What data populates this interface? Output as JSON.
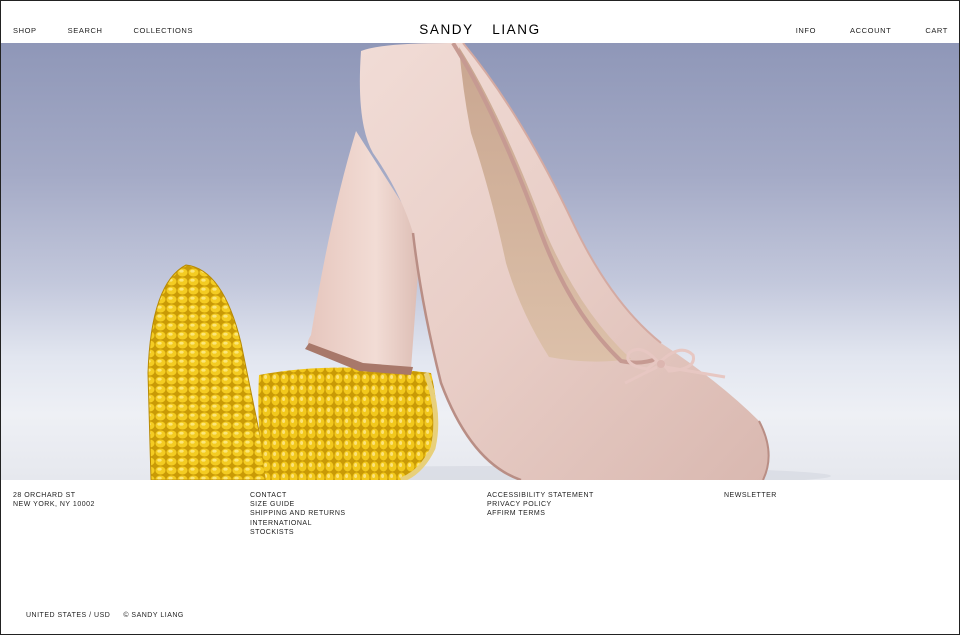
{
  "header": {
    "brand": "SANDY  LIANG",
    "nav_left": [
      {
        "label": "SHOP"
      },
      {
        "label": "SEARCH"
      },
      {
        "label": "COLLECTIONS"
      }
    ],
    "nav_right": [
      {
        "label": "INFO"
      },
      {
        "label": "ACCOUNT"
      },
      {
        "label": "CART"
      }
    ]
  },
  "hero": {
    "image_subject": "pink satin high-heel pump with bow resting on corn cobs",
    "colors": {
      "shoe": "#e9cfc8",
      "corn": "#f2c81c",
      "background_top": "#8f97b8"
    }
  },
  "footer": {
    "address": [
      "28 ORCHARD ST",
      "NEW YORK, NY 10002"
    ],
    "links_col1": [
      "CONTACT",
      "SIZE GUIDE",
      "SHIPPING AND RETURNS",
      "INTERNATIONAL",
      "STOCKISTS"
    ],
    "links_col2": [
      "ACCESSIBILITY STATEMENT",
      "PRIVACY POLICY",
      "AFFIRM TERMS"
    ],
    "newsletter": "NEWSLETTER",
    "locale": "UNITED STATES / USD",
    "copyright": "© SANDY LIANG"
  }
}
